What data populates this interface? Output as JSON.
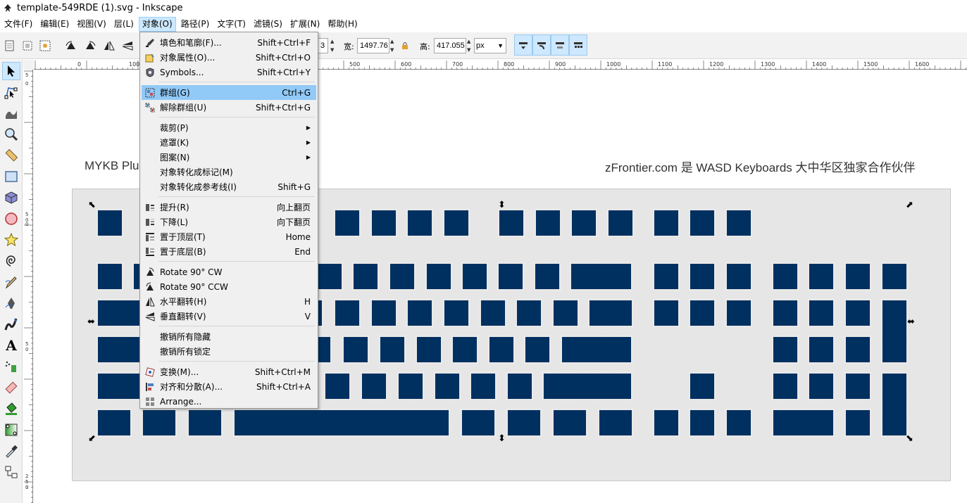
{
  "window": {
    "title": "template-549RDE (1).svg - Inkscape"
  },
  "menubar": [
    "文件(F)",
    "编辑(E)",
    "视图(V)",
    "层(L)",
    "对象(O)",
    "路径(P)",
    "文字(T)",
    "滤镜(S)",
    "扩展(N)",
    "帮助(H)"
  ],
  "tool_controls": {
    "y_value_partial": "3",
    "w_label": "宽:",
    "w_value": "1497.76",
    "h_label": "高:",
    "h_value": "417.055",
    "unit": "px"
  },
  "ruler": {
    "h_labels": [
      "0",
      "100",
      "500",
      "600",
      "700",
      "800",
      "900",
      "1000",
      "1100",
      "1200",
      "1300",
      "1400",
      "1500",
      "1600"
    ],
    "v_labels": [
      "5",
      "0",
      "5",
      "0",
      "0",
      "5",
      "0",
      "2",
      "5",
      "0",
      "0"
    ]
  },
  "canvas": {
    "left_caption": "MYKB Plu",
    "right_caption": "zFrontier.com 是  WASD Keyboards 大中华区独家合作伙伴"
  },
  "object_menu": {
    "items": [
      {
        "label": "填色和笔廓(F)...",
        "shortcut": "Shift+Ctrl+F",
        "icon": "fill-stroke-icon"
      },
      {
        "label": "对象属性(O)...",
        "shortcut": "Shift+Ctrl+O",
        "icon": "object-properties-icon"
      },
      {
        "label": "Symbols...",
        "shortcut": "Shift+Ctrl+Y",
        "icon": "symbols-icon"
      },
      {
        "label": "群组(G)",
        "shortcut": "Ctrl+G",
        "icon": "group-icon",
        "highlighted": true
      },
      {
        "label": "解除群组(U)",
        "shortcut": "Shift+Ctrl+G",
        "icon": "ungroup-icon"
      },
      {
        "label": "裁剪(P)",
        "submenu": true
      },
      {
        "label": "遮罩(K)",
        "submenu": true
      },
      {
        "label": "图案(N)",
        "submenu": true
      },
      {
        "label": "对象转化成标记(M)",
        "shortcut": ""
      },
      {
        "label": "对象转化成参考线(I)",
        "shortcut": "Shift+G"
      },
      {
        "label": "提升(R)",
        "shortcut": "向上翻页",
        "icon": "raise-icon"
      },
      {
        "label": "下降(L)",
        "shortcut": "向下翻页",
        "icon": "lower-icon"
      },
      {
        "label": "置于顶层(T)",
        "shortcut": "Home",
        "icon": "raise-to-top-icon"
      },
      {
        "label": "置于底层(B)",
        "shortcut": "End",
        "icon": "lower-to-bottom-icon"
      },
      {
        "label": "Rotate 90° CW",
        "shortcut": "",
        "icon": "rotate-cw-icon"
      },
      {
        "label": "Rotate 90° CCW",
        "shortcut": "",
        "icon": "rotate-ccw-icon"
      },
      {
        "label": "水平翻转(H)",
        "shortcut": "H",
        "icon": "flip-horizontal-icon"
      },
      {
        "label": "垂直翻转(V)",
        "shortcut": "V",
        "icon": "flip-vertical-icon"
      },
      {
        "label": "撤销所有隐藏",
        "shortcut": ""
      },
      {
        "label": "撤销所有锁定",
        "shortcut": ""
      },
      {
        "label": "变换(M)...",
        "shortcut": "Shift+Ctrl+M",
        "icon": "transform-icon"
      },
      {
        "label": "对齐和分散(A)...",
        "shortcut": "Shift+Ctrl+A",
        "icon": "align-distribute-icon"
      },
      {
        "label": "Arrange...",
        "shortcut": "",
        "icon": "arrange-icon"
      }
    ]
  },
  "colors": {
    "key": "#003060",
    "plate": "#e6e6e6",
    "menu_highlight": "#91c9f7",
    "menubar_active": "#cce8ff"
  }
}
